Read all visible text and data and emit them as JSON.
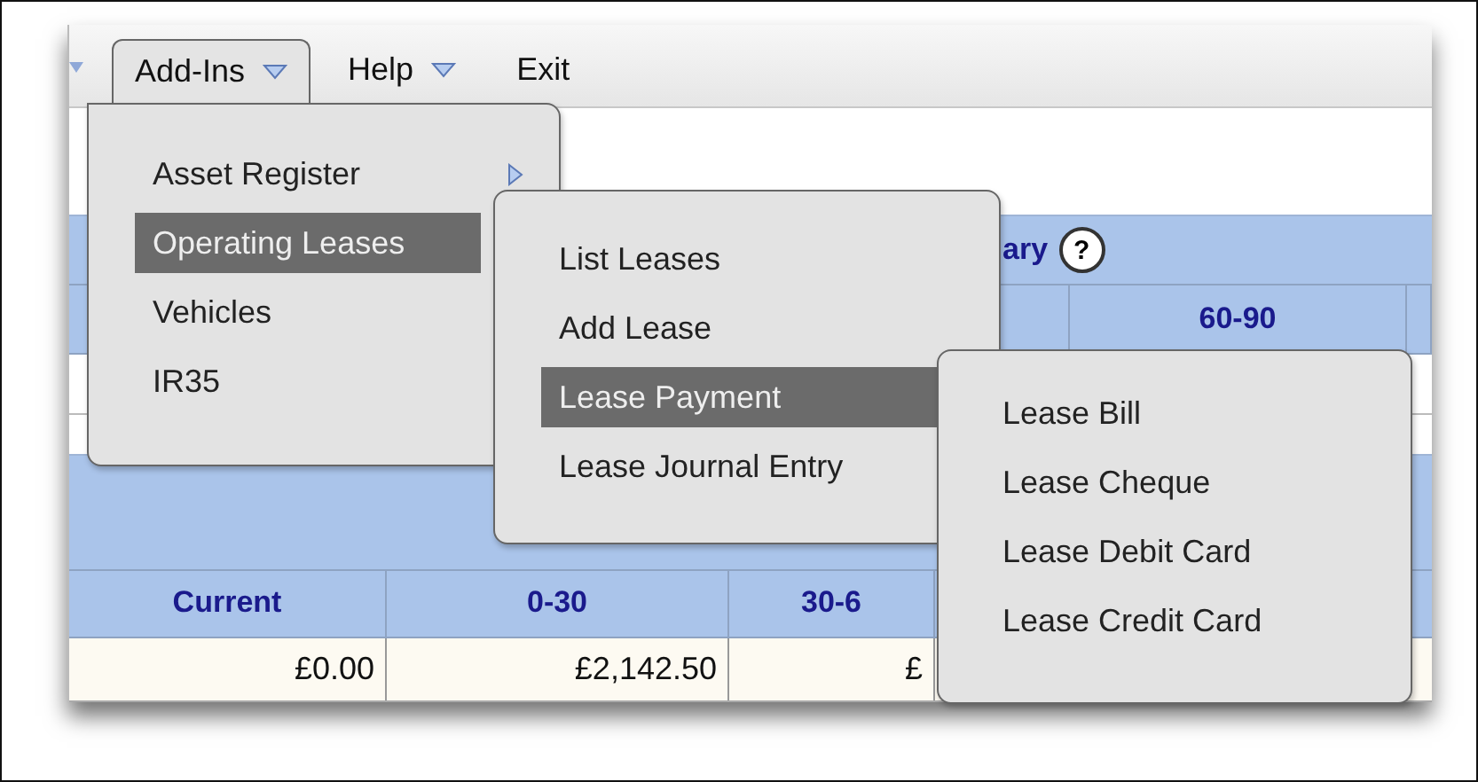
{
  "menubar": [
    {
      "label": "Add-Ins",
      "dropdown": true,
      "selected": true
    },
    {
      "label": "Help",
      "dropdown": true,
      "selected": false
    },
    {
      "label": "Exit",
      "dropdown": false,
      "selected": false
    }
  ],
  "summary": {
    "title": "ary",
    "help": "?",
    "columns": [
      "60-90"
    ]
  },
  "aged_table": {
    "columns": [
      "Current",
      "0-30",
      "30-6"
    ],
    "rows": [
      [
        "£0.00",
        "£2,142.50",
        "£"
      ]
    ]
  },
  "menus": [
    {
      "items": [
        {
          "label": "Asset Register",
          "submenu": true,
          "selected": false
        },
        {
          "label": "Operating Leases",
          "submenu": false,
          "selected": true
        },
        {
          "label": "Vehicles",
          "submenu": false,
          "selected": false
        },
        {
          "label": "IR35",
          "submenu": false,
          "selected": false
        }
      ]
    },
    {
      "items": [
        {
          "label": "List Leases",
          "submenu": false,
          "selected": false
        },
        {
          "label": "Add Lease",
          "submenu": false,
          "selected": false
        },
        {
          "label": "Lease Payment",
          "submenu": false,
          "selected": true
        },
        {
          "label": "Lease Journal Entry",
          "submenu": false,
          "selected": false
        }
      ]
    },
    {
      "items": [
        {
          "label": "Lease Bill",
          "submenu": false,
          "selected": false
        },
        {
          "label": "Lease Cheque",
          "submenu": false,
          "selected": false
        },
        {
          "label": "Lease Debit Card",
          "submenu": false,
          "selected": false
        },
        {
          "label": "Lease Credit Card",
          "submenu": false,
          "selected": false
        }
      ]
    }
  ]
}
